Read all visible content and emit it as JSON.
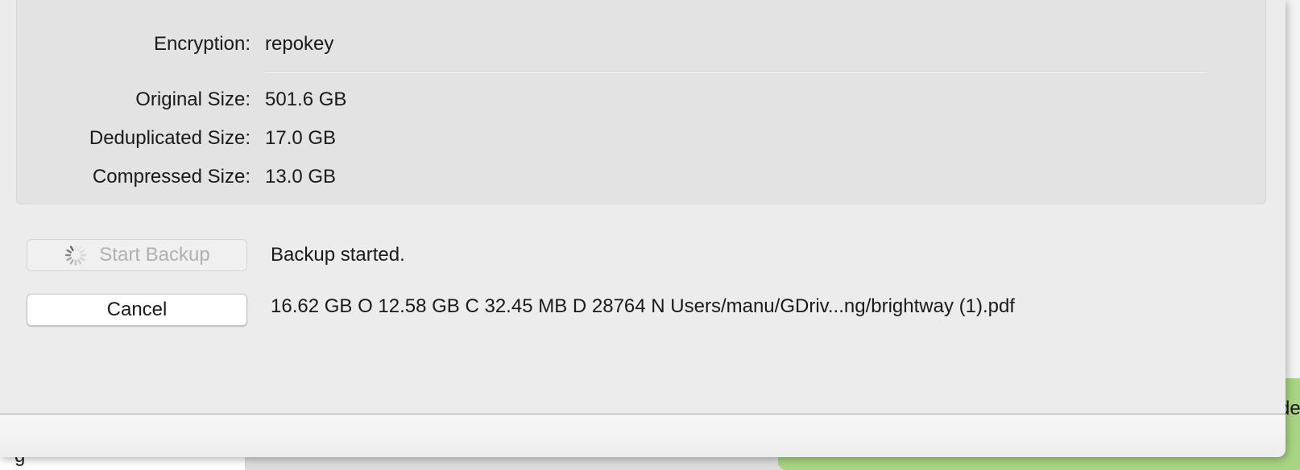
{
  "background": {
    "left_text": "g",
    "toast_text": "de"
  },
  "repo_info": {
    "rows": [
      {
        "label": "Encryption:",
        "value": "repokey"
      },
      {
        "label": "Original Size:",
        "value": "501.6 GB"
      },
      {
        "label": "Deduplicated Size:",
        "value": "17.0 GB"
      },
      {
        "label": "Compressed Size:",
        "value": "13.0 GB"
      }
    ]
  },
  "actions": {
    "start_backup_label": "Start Backup",
    "start_backup_enabled": false,
    "status_text": "Backup started.",
    "cancel_label": "Cancel",
    "progress_text": "16.62 GB O 12.58 GB C 32.45 MB D 28764 N Users/manu/GDriv...ng/brightway (1).pdf"
  },
  "colors": {
    "toast_green": "#a8d483",
    "disabled_text": "#b0b0b0"
  },
  "icons": {
    "busy": "spinner-icon"
  }
}
